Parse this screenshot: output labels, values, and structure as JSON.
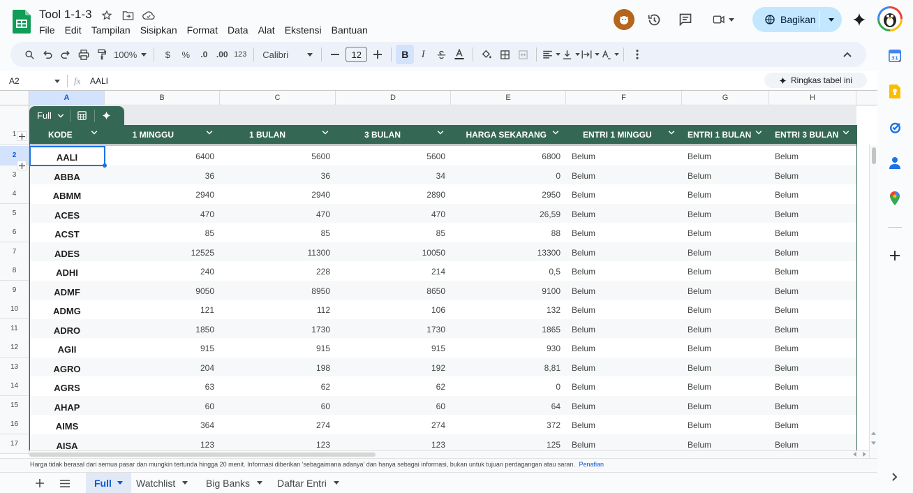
{
  "doc": {
    "title": "Tool 1-1-3",
    "menus": [
      "File",
      "Edit",
      "Tampilan",
      "Sisipkan",
      "Format",
      "Data",
      "Alat",
      "Ekstensi",
      "Bantuan"
    ]
  },
  "share": {
    "label": "Bagikan"
  },
  "toolbar": {
    "zoom": "100%",
    "currency": "$",
    "percent": "%",
    "dec_less": ".0",
    "dec_more": ".00",
    "format_num": "123",
    "font": "Calibri",
    "font_size": "12",
    "bold": "B",
    "italic": "I"
  },
  "formula": {
    "cell_ref": "A2",
    "fx": "fx",
    "value": "AALI",
    "summary_btn": "Ringkas tabel ini"
  },
  "columns": [
    "A",
    "B",
    "C",
    "D",
    "E",
    "F",
    "G",
    "H"
  ],
  "table": {
    "view_label": "Full",
    "headers": [
      "KODE",
      "1 MINGGU",
      "1 BULAN",
      "3 BULAN",
      "HARGA SEKARANG",
      "ENTRI 1 MINGGU",
      "ENTRI 1 BULAN",
      "ENTRI 3 BULAN"
    ],
    "rows": [
      {
        "n": "2",
        "c": [
          "AALI",
          "6400",
          "5600",
          "5600",
          "6800",
          "Belum",
          "Belum",
          "Belum"
        ]
      },
      {
        "n": "3",
        "c": [
          "ABBA",
          "36",
          "36",
          "34",
          "0",
          "Belum",
          "Belum",
          "Belum"
        ]
      },
      {
        "n": "4",
        "c": [
          "ABMM",
          "2940",
          "2940",
          "2890",
          "2950",
          "Belum",
          "Belum",
          "Belum"
        ]
      },
      {
        "n": "5",
        "c": [
          "ACES",
          "470",
          "470",
          "470",
          "26,59",
          "Belum",
          "Belum",
          "Belum"
        ]
      },
      {
        "n": "6",
        "c": [
          "ACST",
          "85",
          "85",
          "85",
          "88",
          "Belum",
          "Belum",
          "Belum"
        ]
      },
      {
        "n": "7",
        "c": [
          "ADES",
          "12525",
          "11300",
          "10050",
          "13300",
          "Belum",
          "Belum",
          "Belum"
        ]
      },
      {
        "n": "8",
        "c": [
          "ADHI",
          "240",
          "228",
          "214",
          "0,5",
          "Belum",
          "Belum",
          "Belum"
        ]
      },
      {
        "n": "9",
        "c": [
          "ADMF",
          "9050",
          "8950",
          "8650",
          "9100",
          "Belum",
          "Belum",
          "Belum"
        ]
      },
      {
        "n": "10",
        "c": [
          "ADMG",
          "121",
          "112",
          "106",
          "132",
          "Belum",
          "Belum",
          "Belum"
        ]
      },
      {
        "n": "11",
        "c": [
          "ADRO",
          "1850",
          "1730",
          "1730",
          "1865",
          "Belum",
          "Belum",
          "Belum"
        ]
      },
      {
        "n": "12",
        "c": [
          "AGII",
          "915",
          "915",
          "915",
          "930",
          "Belum",
          "Belum",
          "Belum"
        ]
      },
      {
        "n": "13",
        "c": [
          "AGRO",
          "204",
          "198",
          "192",
          "8,81",
          "Belum",
          "Belum",
          "Belum"
        ]
      },
      {
        "n": "14",
        "c": [
          "AGRS",
          "63",
          "62",
          "62",
          "0",
          "Belum",
          "Belum",
          "Belum"
        ]
      },
      {
        "n": "15",
        "c": [
          "AHAP",
          "60",
          "60",
          "60",
          "64",
          "Belum",
          "Belum",
          "Belum"
        ]
      },
      {
        "n": "16",
        "c": [
          "AIMS",
          "364",
          "274",
          "274",
          "372",
          "Belum",
          "Belum",
          "Belum"
        ]
      },
      {
        "n": "17",
        "c": [
          "AISA",
          "123",
          "123",
          "123",
          "125",
          "Belum",
          "Belum",
          "Belum"
        ]
      }
    ]
  },
  "header_row_num": "1",
  "disclaimer": {
    "text": "Harga tidak berasal dari semua pasar dan mungkin tertunda hingga 20 menit. Informasi diberikan 'sebagaimana adanya' dan hanya sebagai informasi, bukan untuk tujuan perdagangan atau saran.",
    "link": "Penafian"
  },
  "sheets": [
    "Full",
    "Watchlist",
    "Big Banks",
    "Daftar Entri"
  ],
  "colors": {
    "header": "#356854",
    "accent": "#0b57d0",
    "share_bg": "#c2e7ff"
  }
}
